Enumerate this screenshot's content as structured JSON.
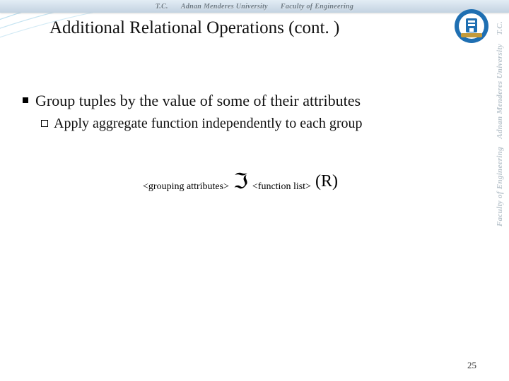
{
  "header": {
    "tc": "T.C.",
    "university": "Adnan Menderes University",
    "faculty": "Faculty of Engineering"
  },
  "sidebar": {
    "tc": "T.C.",
    "university": "Adnan Menderes University",
    "faculty": "Faculty of Engineering"
  },
  "slide": {
    "title": "Additional Relational Operations (cont. )",
    "bullet": "Group tuples by the value of some of their attributes",
    "subbullet": "Apply aggregate function independently to each group"
  },
  "formula": {
    "grouping": "<grouping attributes>",
    "symbol": "ℑ",
    "funclist": "<function list>",
    "relation": "(R)"
  },
  "page": "25"
}
